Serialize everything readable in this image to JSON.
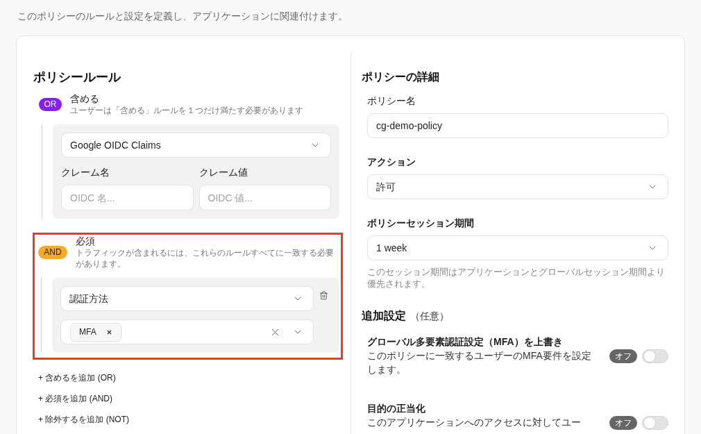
{
  "intro": "このポリシーのルールと設定を定義し、アプリケーションに関連付けます。",
  "policy_rules": {
    "title": "ポリシールール",
    "groups": [
      {
        "kind": "or",
        "badge": "OR",
        "title": "含める",
        "description": "ユーザーは「含める」ルールを１つだけ満たす必要があります",
        "highlighted": false,
        "rules": [
          {
            "kind": "claims",
            "deletable": false,
            "source": "Google OIDC Claims",
            "fields": [
              {
                "label": "クレーム名",
                "placeholder": "OIDC 名..."
              },
              {
                "label": "クレーム値",
                "placeholder": "OIDC 値..."
              }
            ]
          }
        ]
      },
      {
        "kind": "and",
        "badge": "AND",
        "title": "必須",
        "description": "トラフィックが含まれるには、これらのルールすべてに一致する必要があります。",
        "highlighted": true,
        "rules": [
          {
            "kind": "method",
            "deletable": true,
            "method": "認証方法",
            "values": [
              "MFA"
            ]
          }
        ]
      }
    ],
    "add_links": [
      "+ 含めるを追加 (OR)",
      "+ 必須を追加 (AND)",
      "+ 除外するを追加 (NOT)"
    ]
  },
  "policy_details": {
    "title": "ポリシーの詳細",
    "fields": [
      {
        "kind": "text",
        "label": "ポリシー名",
        "value": "cg-demo-policy"
      },
      {
        "kind": "select",
        "label": "アクション",
        "value": "許可"
      },
      {
        "kind": "select",
        "label": "ポリシーセッション期間",
        "value": "1 week",
        "hint": "このセッション期間はアプリケーションとグローバルセッション期間より優先されます。"
      }
    ]
  },
  "additional_settings": {
    "title": "追加設定",
    "note": "（任意）",
    "toggles": [
      {
        "title": "グローバル多要素認証設定（MFA）を上書き",
        "description": "このポリシーに一致するユーザーのMFA要件を設定します。",
        "on": false,
        "state_label": "オフ"
      },
      {
        "title": "目的の正当化",
        "description": "このアプリケーションへのアクセスに対してユー",
        "on": false,
        "state_label": "オフ"
      }
    ]
  }
}
